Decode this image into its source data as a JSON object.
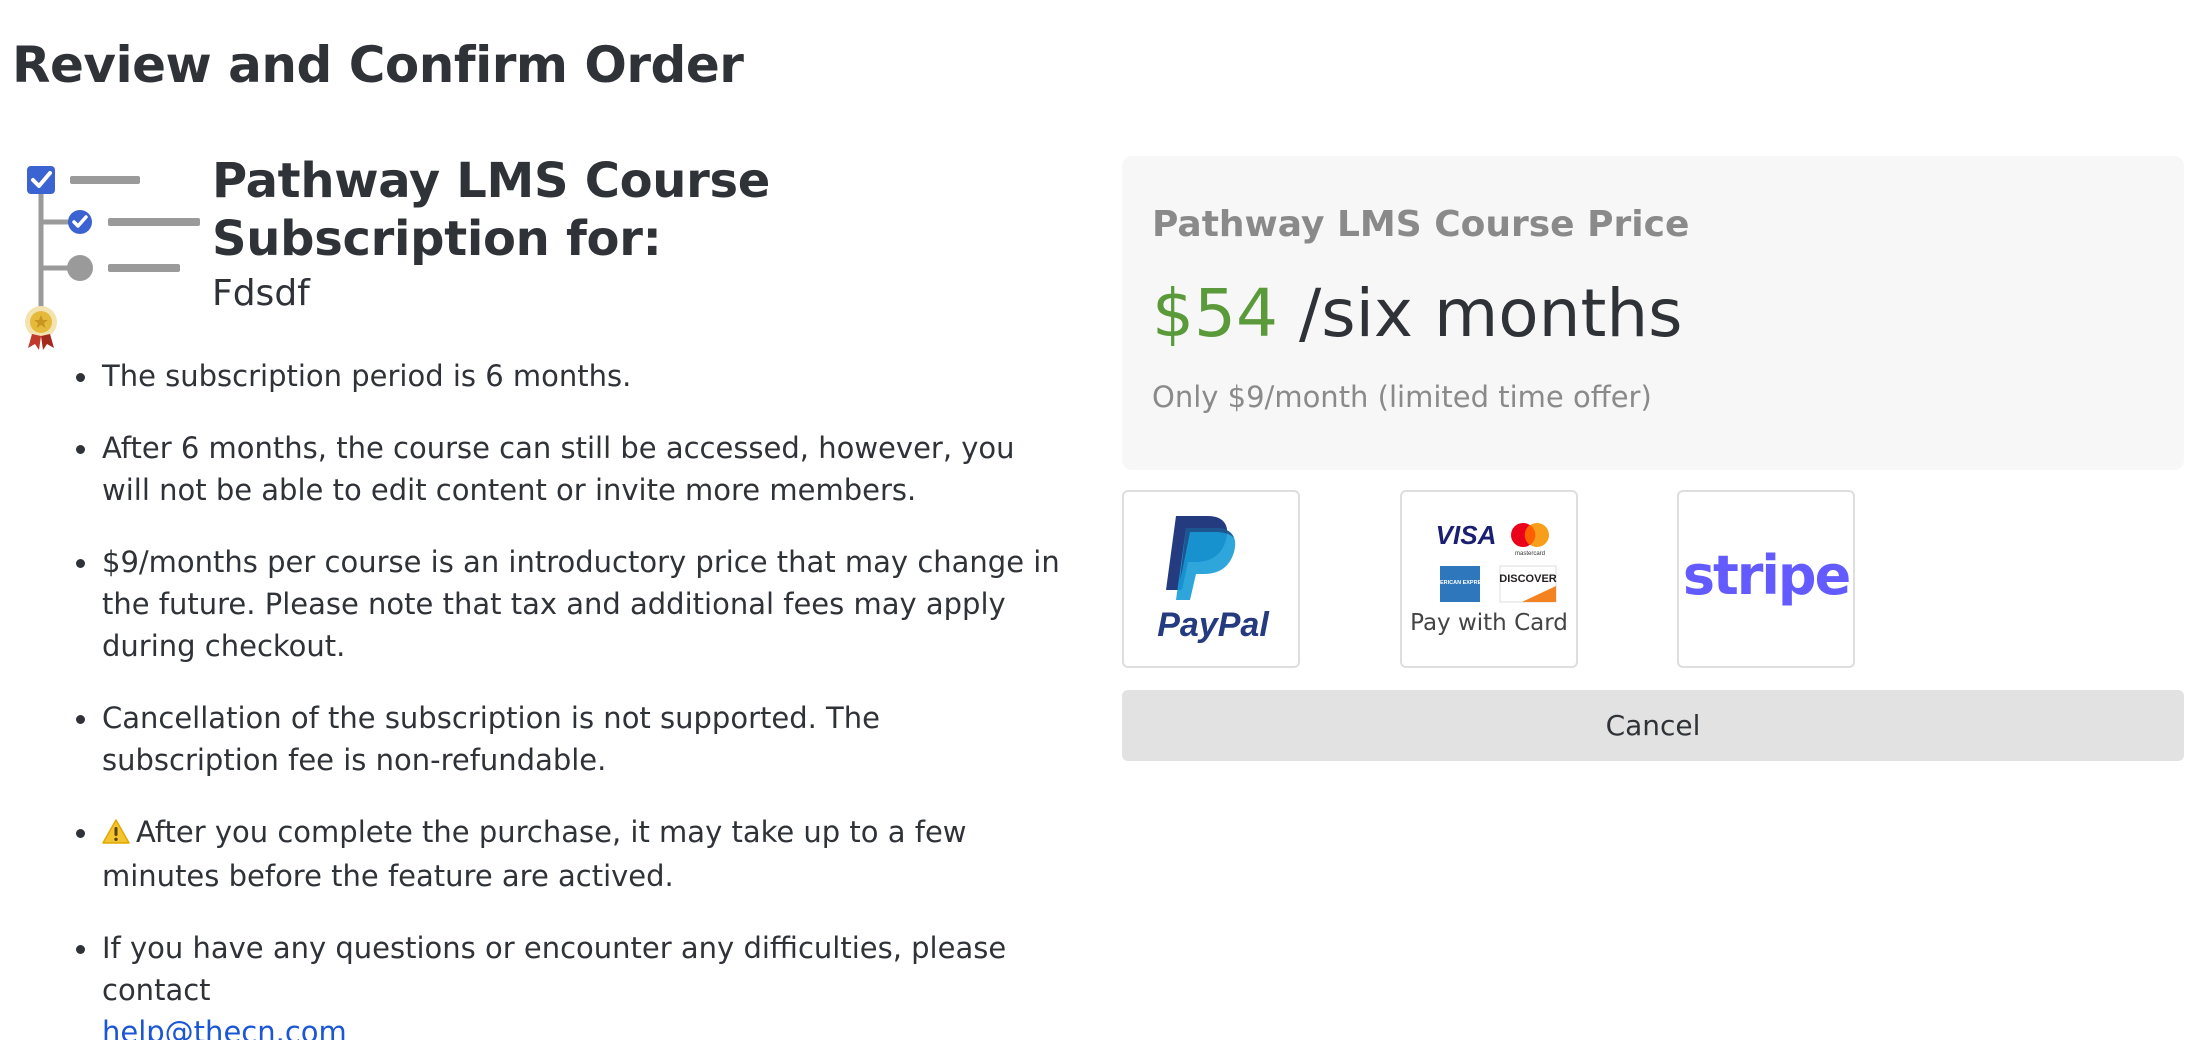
{
  "page": {
    "title": "Review and Confirm Order"
  },
  "course": {
    "icon": "course-checklist-icon",
    "title": "Pathway LMS Course Subscription for:",
    "subtitle": "Fdsdf"
  },
  "terms": [
    {
      "text": "The subscription period is 6 months."
    },
    {
      "text": "After 6 months, the course can still be accessed, however, you will not be able to edit content or invite more members."
    },
    {
      "text": "$9/months per course is an introductory price that may change in the future. Please note that tax and additional fees may apply during checkout."
    },
    {
      "text": "Cancellation of the subscription is not supported. The subscription fee is non-refundable."
    },
    {
      "icon": "warning-icon",
      "text": "After you complete the purchase, it may take up to a few minutes before the feature are actived."
    },
    {
      "text": "If you have any questions or encounter any difficulties, please contact",
      "link": "help@thecn.com"
    }
  ],
  "pricing": {
    "label": "Pathway LMS Course Price",
    "amount": "$54",
    "period": "/six months",
    "note": "Only $9/month (limited time offer)"
  },
  "payment": {
    "paypal": {
      "icon": "paypal-logo",
      "brand": "PayPal"
    },
    "card": {
      "icon": "credit-cards-icon",
      "label": "Pay with Card",
      "brands": [
        "VISA",
        "mastercard",
        "AMERICAN EXPRESS",
        "DISCOVER"
      ]
    },
    "stripe": {
      "icon": "stripe-logo",
      "brand": "stripe"
    }
  },
  "actions": {
    "cancel_label": "Cancel"
  },
  "colors": {
    "price_green": "#5a9a3a",
    "link_blue": "#1a56d6",
    "stripe_purple": "#635bff",
    "paypal_dark": "#253b80",
    "paypal_light": "#179bd7"
  }
}
